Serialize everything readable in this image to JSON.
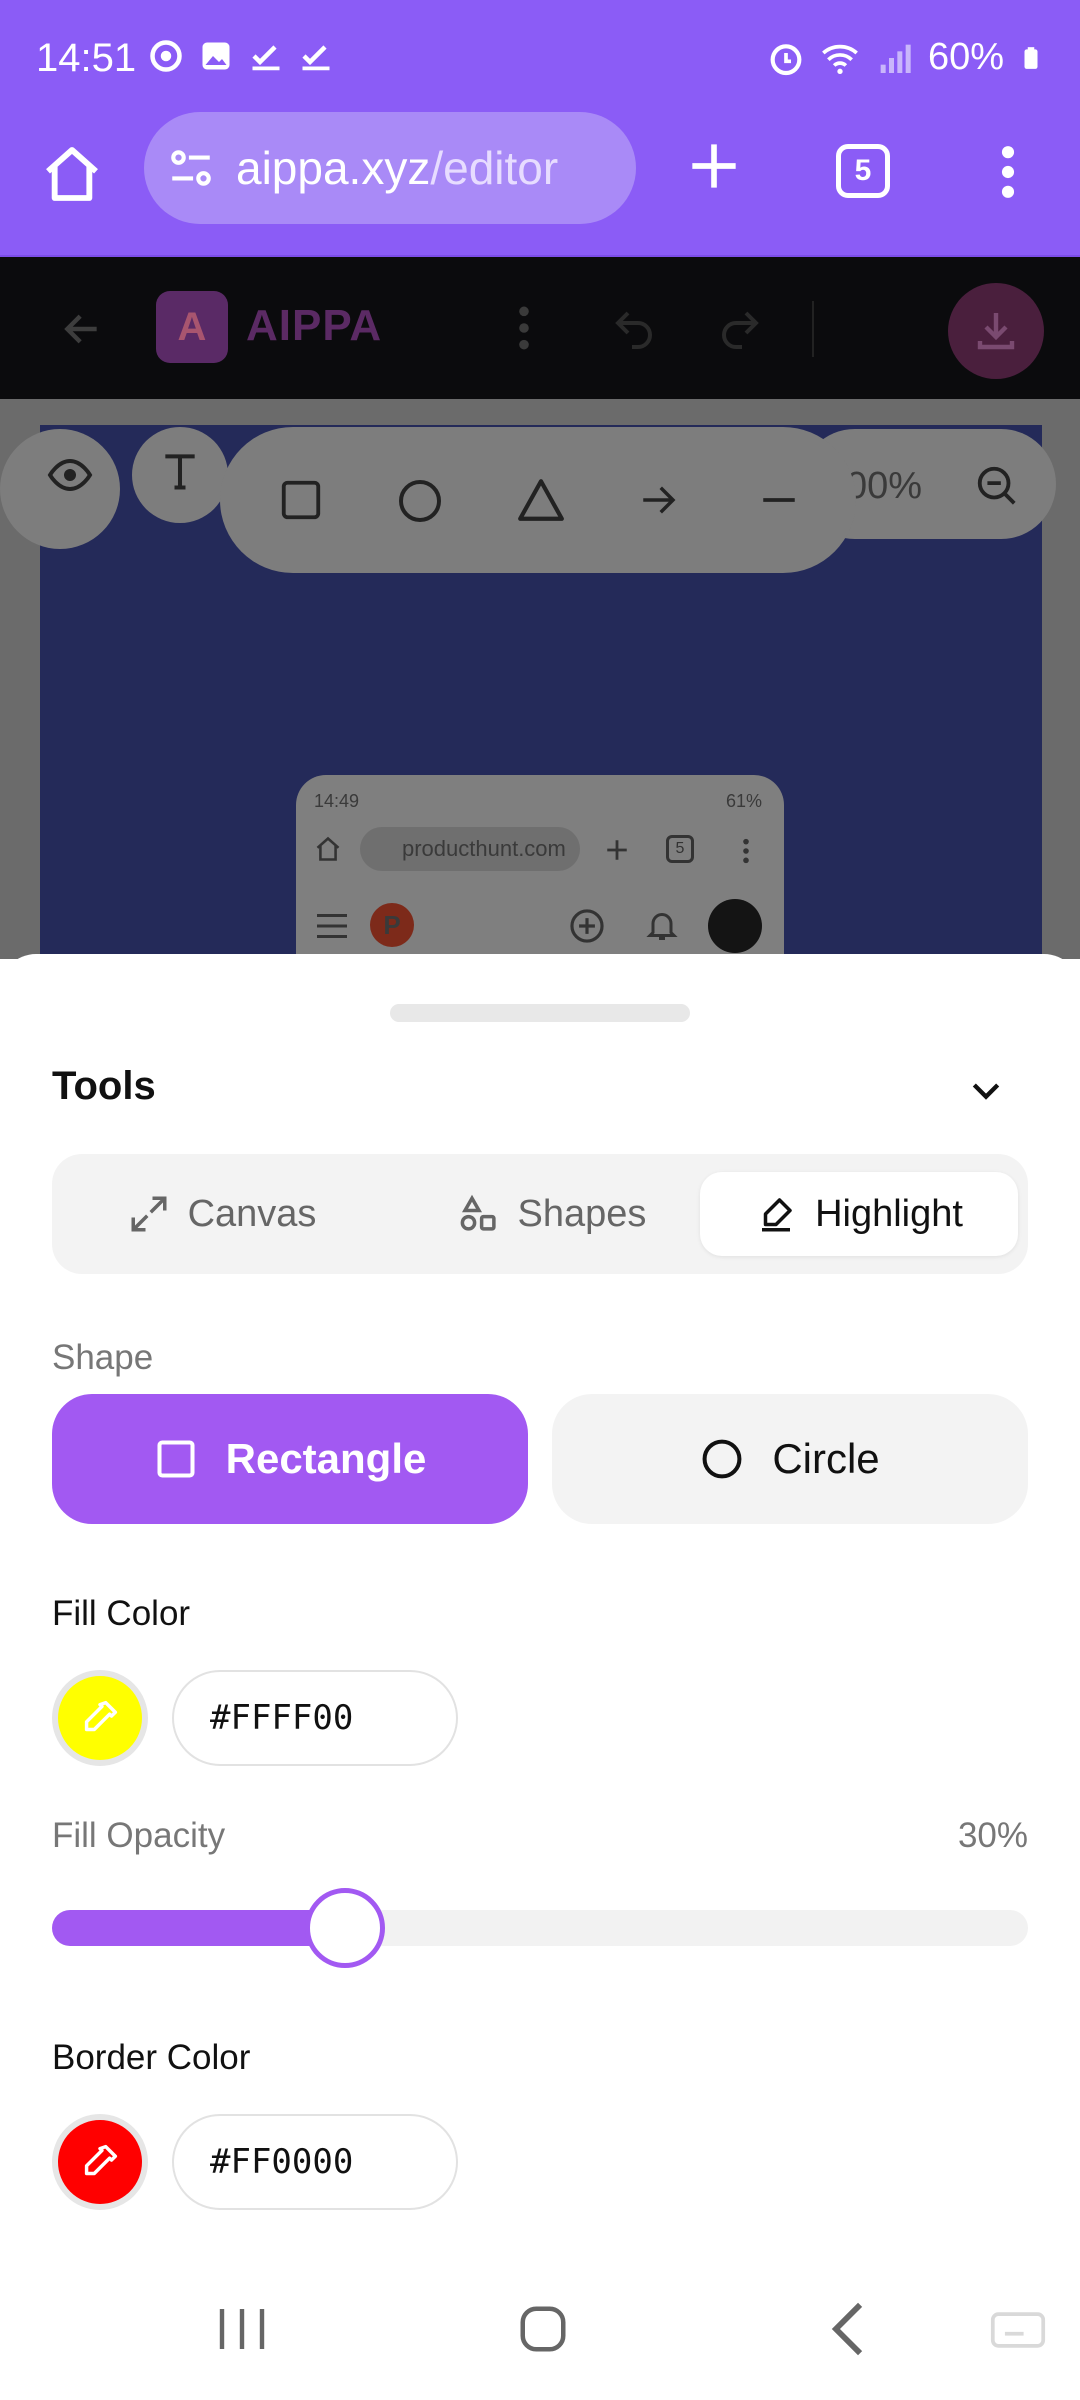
{
  "status_bar": {
    "time": "14:51",
    "battery": "60%"
  },
  "browser": {
    "url_host": "aippa.xyz",
    "url_path": "/editor",
    "tab_count": "5"
  },
  "app_header": {
    "logo_letter": "A",
    "app_name": "AIPPA"
  },
  "editor": {
    "zoom_label": "00%",
    "preview": {
      "time": "14:49",
      "battery": "61%",
      "url": "producthunt.com",
      "tab_count": "5",
      "logo_letter": "P"
    }
  },
  "sheet": {
    "title": "Tools",
    "tabs": [
      {
        "label": "Canvas",
        "icon": "expand-icon"
      },
      {
        "label": "Shapes",
        "icon": "shapes-icon"
      },
      {
        "label": "Highlight",
        "icon": "highlighter-icon",
        "active": true
      }
    ],
    "shape_label": "Shape",
    "shape_options": [
      {
        "label": "Rectangle",
        "selected": true
      },
      {
        "label": "Circle",
        "selected": false
      }
    ],
    "fill_color_label": "Fill Color",
    "fill_color_value": "#FFFF00",
    "fill_opacity_label": "Fill Opacity",
    "fill_opacity_value": "30%",
    "fill_opacity_fraction": 0.3,
    "border_color_label": "Border Color",
    "border_color_value": "#FF0000"
  },
  "colors": {
    "accent": "#a259f2",
    "browser_bar": "#8b5cf6",
    "fill_swatch": "#FFFF00",
    "border_swatch": "#FF0000"
  }
}
